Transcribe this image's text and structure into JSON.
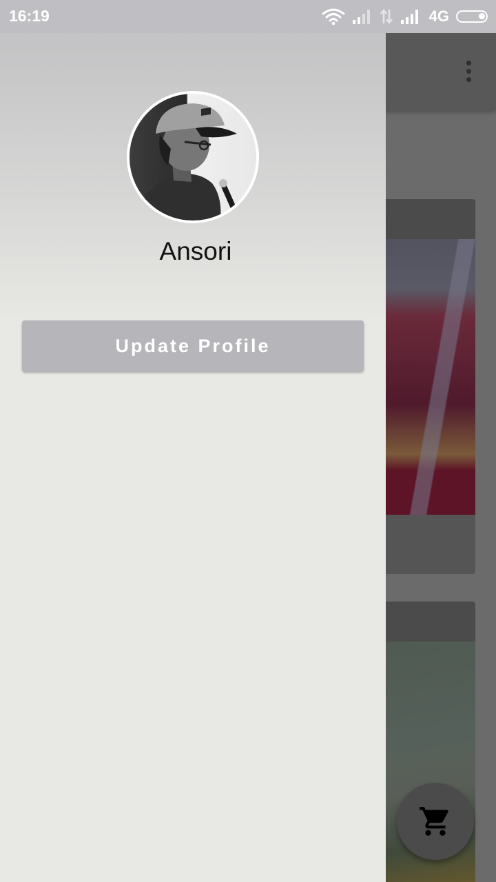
{
  "status_bar": {
    "time": "16:19",
    "network_type": "4G",
    "icons": [
      "wifi-icon",
      "signal-weak-icon",
      "data-arrows-icon",
      "signal-full-icon",
      "battery-icon"
    ]
  },
  "drawer": {
    "user_name": "Ansori",
    "avatar_icon": "profile-photo",
    "update_profile_label": "Update Profile"
  },
  "background_app": {
    "toolbar_icons": [
      "overflow-menu-icon"
    ],
    "fab_icon": "shopping-cart-icon"
  },
  "colors": {
    "drawer_background": "#e8e8e4",
    "button_background": "#b6b6ba",
    "scrim": "#6b6b6b",
    "fab_background": "#4b4b4b"
  }
}
